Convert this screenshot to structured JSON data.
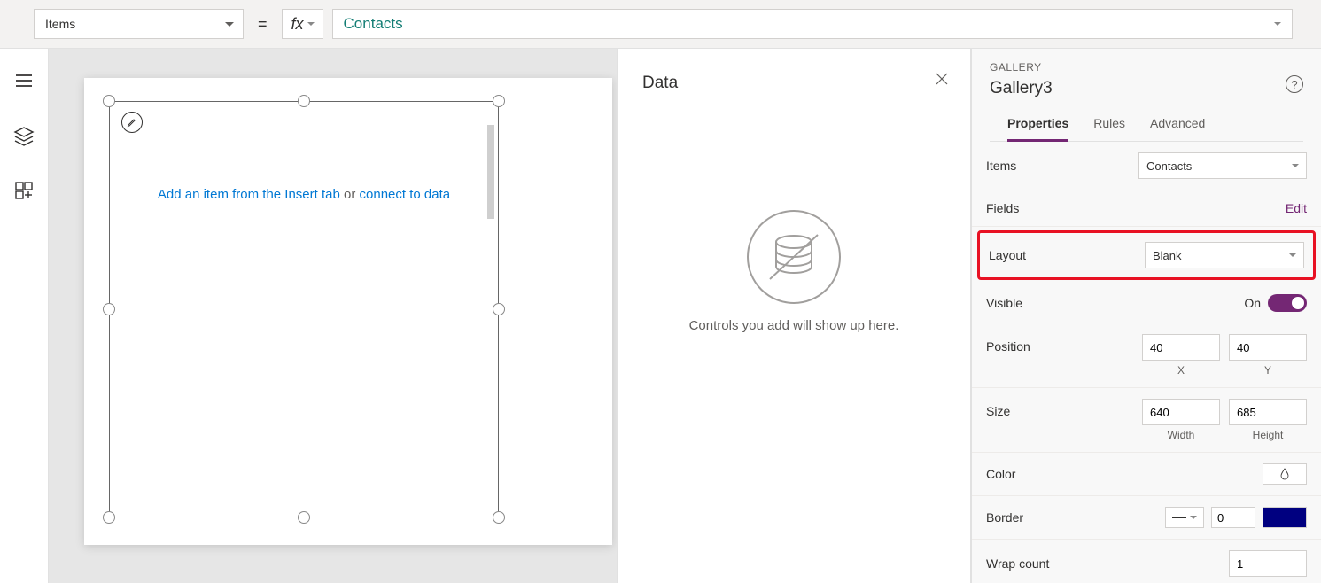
{
  "formula": {
    "property": "Items",
    "fx": "fx",
    "value": "Contacts"
  },
  "canvas": {
    "insert_text_pre": "Add an item from the Insert tab ",
    "insert_text_or": "or ",
    "insert_text_link": "connect to data"
  },
  "data_panel": {
    "title": "Data",
    "message": "Controls you add will show up here."
  },
  "props": {
    "category": "GALLERY",
    "name": "Gallery3",
    "tabs": {
      "properties": "Properties",
      "rules": "Rules",
      "advanced": "Advanced"
    },
    "items": {
      "label": "Items",
      "value": "Contacts"
    },
    "fields": {
      "label": "Fields",
      "link": "Edit"
    },
    "layout": {
      "label": "Layout",
      "value": "Blank"
    },
    "visible": {
      "label": "Visible",
      "state": "On"
    },
    "position": {
      "label": "Position",
      "x": "40",
      "y": "40",
      "xlabel": "X",
      "ylabel": "Y"
    },
    "size": {
      "label": "Size",
      "w": "640",
      "h": "685",
      "wlabel": "Width",
      "hlabel": "Height"
    },
    "color": {
      "label": "Color"
    },
    "border": {
      "label": "Border",
      "width": "0"
    },
    "wrap": {
      "label": "Wrap count",
      "value": "1"
    }
  }
}
